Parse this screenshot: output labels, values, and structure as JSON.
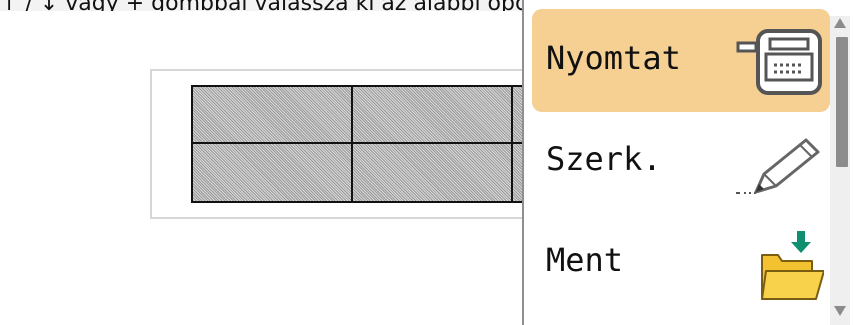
{
  "instruction": "↑ / ↓ vagy + gombbal válassza ki az alábbi opciók egyikét.",
  "preview": {},
  "menu": {
    "items": [
      {
        "label": "Nyomtat",
        "icon": "printer-icon",
        "selected": true
      },
      {
        "label": "Szerk.",
        "icon": "pencil-icon",
        "selected": false
      },
      {
        "label": "Ment",
        "icon": "folder-save-icon",
        "selected": false
      }
    ]
  },
  "scroll": {
    "up_icon": "triangle-up-icon",
    "down_icon": "triangle-down-icon"
  },
  "colors": {
    "selected_bg": "#f6cf93",
    "folder": "#f2c230",
    "arrow_green": "#0f8f6d"
  }
}
